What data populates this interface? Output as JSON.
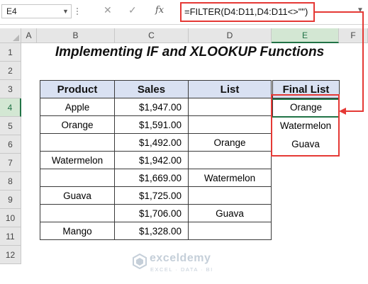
{
  "formula_bar": {
    "name_box": "E4",
    "cancel_icon": "✕",
    "enter_icon": "✓",
    "fx_label": "fx",
    "formula": "=FILTER(D4:D11,D4:D11<>\"\")"
  },
  "columns": [
    "A",
    "B",
    "C",
    "D",
    "E",
    "F"
  ],
  "rows": [
    "1",
    "2",
    "3",
    "4",
    "5",
    "6",
    "7",
    "8",
    "9",
    "10",
    "11",
    "12"
  ],
  "selected_cell": "E4",
  "title": "Implementing IF and XLOOKUP Functions",
  "table": {
    "headers": [
      "Product",
      "Sales",
      "List",
      "Final List"
    ],
    "rows": [
      [
        "Apple",
        "$1,947.00",
        "",
        "Orange"
      ],
      [
        "Orange",
        "$1,591.00",
        "",
        "Watermelon"
      ],
      [
        "",
        "$1,492.00",
        "Orange",
        "Guava"
      ],
      [
        "Watermelon",
        "$1,942.00",
        "",
        ""
      ],
      [
        "",
        "$1,669.00",
        "Watermelon",
        ""
      ],
      [
        "Guava",
        "$1,725.00",
        "",
        ""
      ],
      [
        "",
        "$1,706.00",
        "Guava",
        ""
      ],
      [
        "Mango",
        "$1,328.00",
        "",
        ""
      ]
    ]
  },
  "watermark": {
    "name": "exceldemy",
    "tagline": "EXCEL · DATA · BI"
  },
  "colors": {
    "accent_red": "#e53935",
    "excel_green": "#217346",
    "header_fill": "#d9e1f2"
  }
}
